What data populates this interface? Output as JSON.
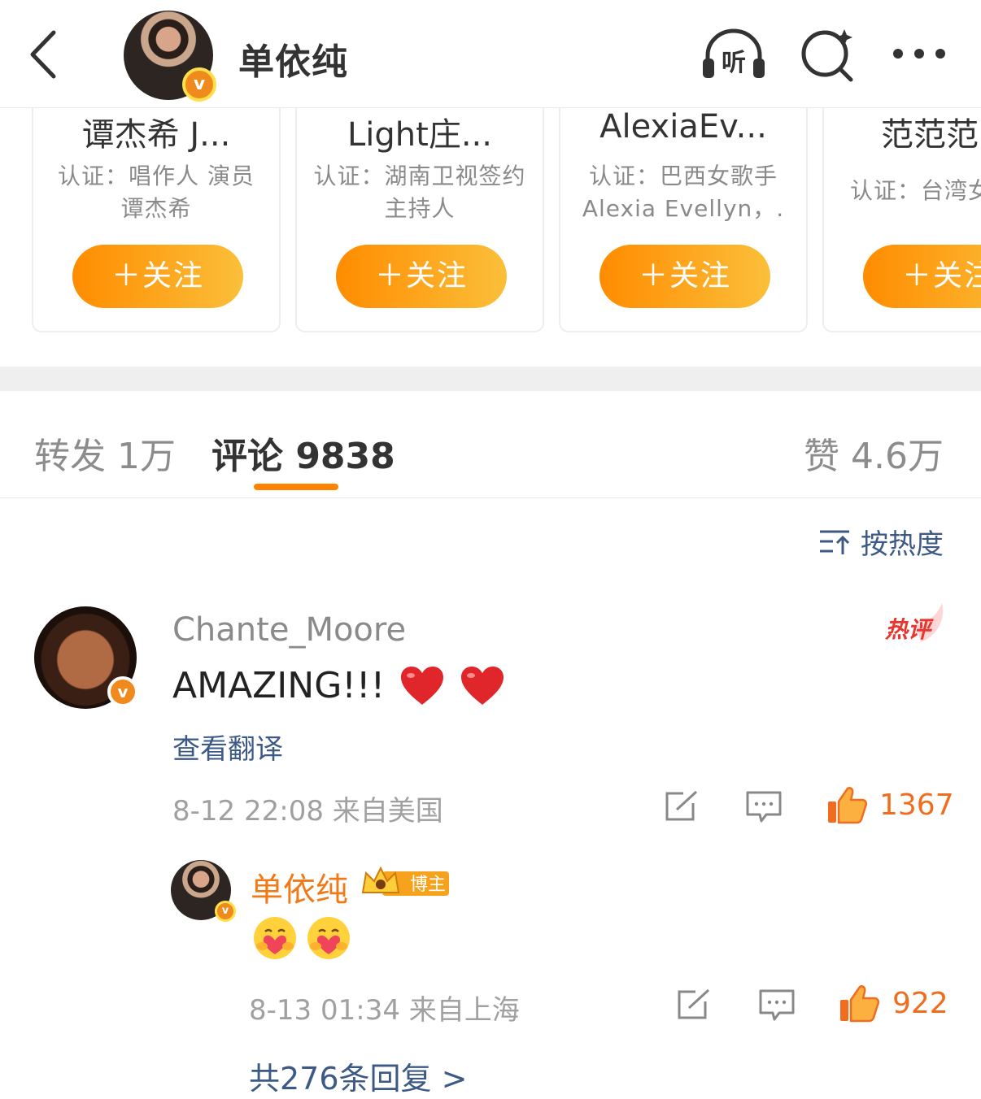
{
  "header": {
    "title": "单依纯",
    "icons": [
      "back-icon",
      "listen-icon",
      "search-icon",
      "more-icon"
    ],
    "listen_label": "听"
  },
  "recommend_cards": [
    {
      "name": "谭杰希 J...",
      "cert": "认证：唱作人 演员 谭杰希",
      "follow_label": "＋关注"
    },
    {
      "name": "Light庄...",
      "cert": "认证：湖南卫视签约主持人",
      "follow_label": "＋关注"
    },
    {
      "name": "AlexiaEv...",
      "cert": "认证：巴西女歌手 Alexia Evellyn，.",
      "follow_label": "＋关注"
    },
    {
      "name": "范范范",
      "cert": "认证：台湾女",
      "follow_label": "＋关注"
    }
  ],
  "tabs": {
    "repost": "转发 1万",
    "comment": "评论 9838",
    "like": "赞 4.6万",
    "active": "comment"
  },
  "sort": {
    "label": "按热度",
    "icon": "sort-icon"
  },
  "comment": {
    "user": "Chante_Moore",
    "hot_tag": "热评",
    "text": "AMAZING!!!",
    "emojis": [
      "red-heart",
      "red-heart"
    ],
    "translate_label": "查看翻译",
    "meta": "8-12 22:08 来自美国",
    "like_count": "1367"
  },
  "reply": {
    "user": "单依纯",
    "badge": "博主",
    "emojis": [
      "hug-face",
      "hug-face"
    ],
    "meta": "8-13 01:34 来自上海",
    "like_count": "922"
  },
  "more_replies": "共276条回复 >",
  "colors": {
    "accent": "#ff8200",
    "link_blue": "#3d5a86",
    "like_orange": "#f06d1f",
    "verified_orange": "#f08a1c"
  }
}
